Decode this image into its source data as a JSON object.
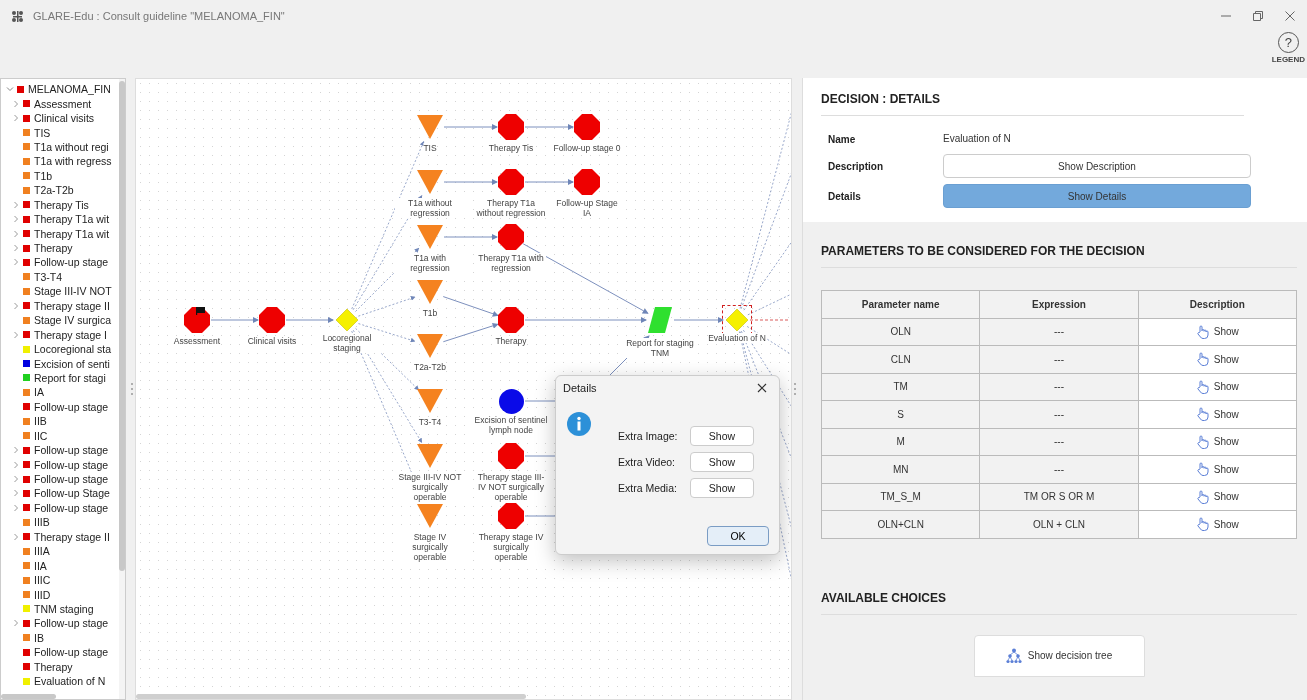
{
  "window": {
    "title": "GLARE-Edu : Consult guideline \"MELANOMA_FIN\""
  },
  "legend": {
    "symbol": "?",
    "label": "LEGEND"
  },
  "tree": {
    "root": {
      "label": "MELANOMA_FIN",
      "color": "#e00000",
      "expanded": true
    },
    "items": [
      {
        "label": "Assessment",
        "color": "#e00000",
        "expandable": true
      },
      {
        "label": "Clinical visits",
        "color": "#e00000",
        "expandable": true
      },
      {
        "label": "TIS",
        "color": "#f08020",
        "expandable": false
      },
      {
        "label": "T1a without regi",
        "color": "#f08020",
        "expandable": false
      },
      {
        "label": "T1a with regress",
        "color": "#f08020",
        "expandable": false
      },
      {
        "label": "T1b",
        "color": "#f08020",
        "expandable": false
      },
      {
        "label": "T2a-T2b",
        "color": "#f08020",
        "expandable": false
      },
      {
        "label": "Therapy Tis",
        "color": "#e00000",
        "expandable": true
      },
      {
        "label": "Therapy T1a wit",
        "color": "#e00000",
        "expandable": true
      },
      {
        "label": "Therapy T1a wit",
        "color": "#e00000",
        "expandable": true
      },
      {
        "label": "Therapy",
        "color": "#e00000",
        "expandable": true
      },
      {
        "label": "Follow-up stage",
        "color": "#e00000",
        "expandable": true
      },
      {
        "label": "T3-T4",
        "color": "#f08020",
        "expandable": false
      },
      {
        "label": "Stage III-IV NOT",
        "color": "#f08020",
        "expandable": false
      },
      {
        "label": "Therapy stage II",
        "color": "#e00000",
        "expandable": true
      },
      {
        "label": "Stage IV surgica",
        "color": "#f08020",
        "expandable": false
      },
      {
        "label": "Therapy stage I",
        "color": "#e00000",
        "expandable": true
      },
      {
        "label": "Locoregional sta",
        "color": "#f0f000",
        "expandable": false
      },
      {
        "label": "Excision of senti",
        "color": "#0000e0",
        "expandable": false
      },
      {
        "label": "Report for stagi",
        "color": "#20d020",
        "expandable": false
      },
      {
        "label": "IA",
        "color": "#f08020",
        "expandable": false
      },
      {
        "label": "Follow-up stage",
        "color": "#e00000",
        "expandable": false
      },
      {
        "label": "IIB",
        "color": "#f08020",
        "expandable": false
      },
      {
        "label": "IIC",
        "color": "#f08020",
        "expandable": false
      },
      {
        "label": "Follow-up stage",
        "color": "#e00000",
        "expandable": true
      },
      {
        "label": "Follow-up stage",
        "color": "#e00000",
        "expandable": true
      },
      {
        "label": "Follow-up stage",
        "color": "#e00000",
        "expandable": true
      },
      {
        "label": "Follow-up Stage",
        "color": "#e00000",
        "expandable": true
      },
      {
        "label": "Follow-up stage",
        "color": "#e00000",
        "expandable": true
      },
      {
        "label": "IIIB",
        "color": "#f08020",
        "expandable": false
      },
      {
        "label": "Therapy stage II",
        "color": "#e00000",
        "expandable": true
      },
      {
        "label": "IIIA",
        "color": "#f08020",
        "expandable": false
      },
      {
        "label": "IIA",
        "color": "#f08020",
        "expandable": false
      },
      {
        "label": "IIIC",
        "color": "#f08020",
        "expandable": false
      },
      {
        "label": "IIID",
        "color": "#f08020",
        "expandable": false
      },
      {
        "label": "TNM staging",
        "color": "#f0f000",
        "expandable": false
      },
      {
        "label": "Follow-up stage",
        "color": "#e00000",
        "expandable": true
      },
      {
        "label": "IB",
        "color": "#f08020",
        "expandable": false
      },
      {
        "label": "Follow-up stage",
        "color": "#e00000",
        "expandable": false
      },
      {
        "label": "Therapy",
        "color": "#e00000",
        "expandable": false
      },
      {
        "label": "Evaluation of N",
        "color": "#f0f000",
        "expandable": false
      }
    ]
  },
  "graph": {
    "nodes": [
      {
        "label": "Assessment",
        "kind": "octagon",
        "selected": false,
        "start": true
      },
      {
        "label": "Clinical visits",
        "kind": "octagon",
        "selected": false,
        "start": false
      },
      {
        "label": "Locoregional staging",
        "kind": "diamond",
        "selected": false,
        "start": false
      },
      {
        "label": "TIS",
        "kind": "triangle",
        "selected": false,
        "start": false
      },
      {
        "label": "T1a without regression",
        "kind": "triangle",
        "selected": false,
        "start": false
      },
      {
        "label": "T1a with regression",
        "kind": "triangle",
        "selected": false,
        "start": false
      },
      {
        "label": "T1b",
        "kind": "triangle",
        "selected": false,
        "start": false
      },
      {
        "label": "T2a-T2b",
        "kind": "triangle",
        "selected": false,
        "start": false
      },
      {
        "label": "T3-T4",
        "kind": "triangle",
        "selected": false,
        "start": false
      },
      {
        "label": "Stage III-IV NOT surgically operable",
        "kind": "triangle",
        "selected": false,
        "start": false
      },
      {
        "label": "Stage IV surgically operable",
        "kind": "triangle",
        "selected": false,
        "start": false
      },
      {
        "label": "Therapy Tis",
        "kind": "octagon",
        "selected": false,
        "start": false
      },
      {
        "label": "Follow-up stage 0",
        "kind": "octagon",
        "selected": false,
        "start": false
      },
      {
        "label": "Therapy T1a without regression",
        "kind": "octagon",
        "selected": false,
        "start": false
      },
      {
        "label": "Follow-up Stage IA",
        "kind": "octagon",
        "selected": false,
        "start": false
      },
      {
        "label": "Therapy T1a with regression",
        "kind": "octagon",
        "selected": false,
        "start": false
      },
      {
        "label": "Therapy",
        "kind": "octagon",
        "selected": false,
        "start": false
      },
      {
        "label": "Excision of sentinel lymph node",
        "kind": "circle",
        "selected": false,
        "start": false
      },
      {
        "label": "Therapy stage III- IV NOT surgically operable",
        "kind": "octagon",
        "selected": false,
        "start": false
      },
      {
        "label": "Therapy stage IV surgically operable",
        "kind": "octagon",
        "selected": false,
        "start": false
      },
      {
        "label": "Report for staging TNM",
        "kind": "parallelogram",
        "selected": false,
        "start": false
      },
      {
        "label": "Evaluation of N",
        "kind": "diamond",
        "selected": true,
        "start": false
      }
    ]
  },
  "dialog": {
    "title": "Details",
    "rows": [
      {
        "label": "Extra Image:",
        "button": "Show"
      },
      {
        "label": "Extra Video:",
        "button": "Show"
      },
      {
        "label": "Extra Media:",
        "button": "Show"
      }
    ],
    "ok": "OK"
  },
  "decision": {
    "title": "DECISION : DETAILS",
    "fields": [
      {
        "label": "Name",
        "kind": "text",
        "value": "Evaluation of N"
      },
      {
        "label": "Description",
        "kind": "button",
        "value": "Show Description",
        "active": false
      },
      {
        "label": "Details",
        "kind": "button",
        "value": "Show Details",
        "active": true
      }
    ]
  },
  "parameters": {
    "title": "PARAMETERS TO BE CONSIDERED FOR THE DECISION",
    "columns": [
      "Parameter name",
      "Expression",
      "Description"
    ],
    "rows": [
      {
        "name": "OLN",
        "expression": "---",
        "description": "Show"
      },
      {
        "name": "CLN",
        "expression": "---",
        "description": "Show"
      },
      {
        "name": "TM",
        "expression": "---",
        "description": "Show"
      },
      {
        "name": "S",
        "expression": "---",
        "description": "Show"
      },
      {
        "name": "M",
        "expression": "---",
        "description": "Show"
      },
      {
        "name": "MN",
        "expression": "---",
        "description": "Show"
      },
      {
        "name": "TM_S_M",
        "expression": "TM OR S OR M",
        "description": "Show"
      },
      {
        "name": "OLN+CLN",
        "expression": "OLN + CLN",
        "description": "Show"
      }
    ]
  },
  "choices": {
    "title": "AVAILABLE CHOICES",
    "button": "Show decision tree"
  }
}
